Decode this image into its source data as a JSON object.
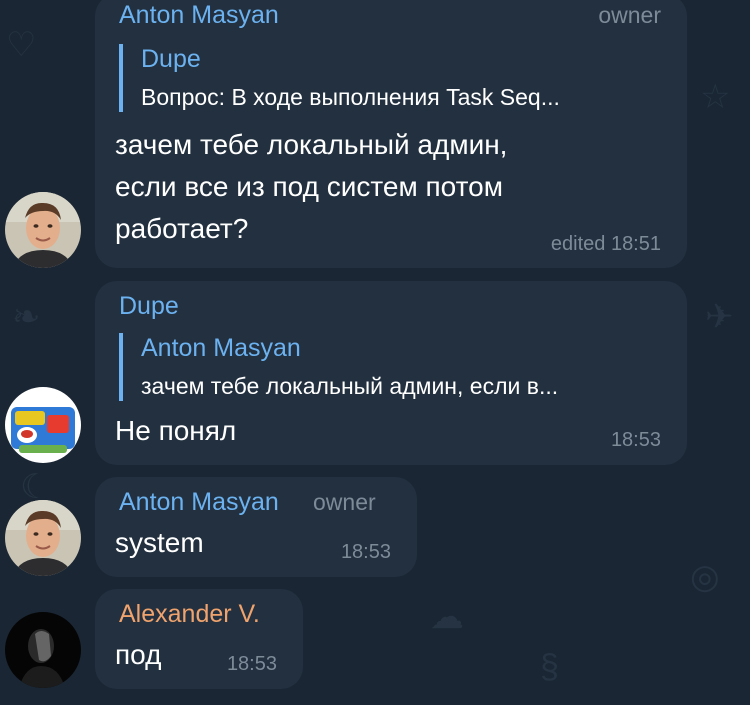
{
  "colors": {
    "background": "#1a2633",
    "bubble": "#22303f",
    "text": "#ffffff",
    "meta": "#7d8b99",
    "accent_blue": "#6cb2f0",
    "accent_orange": "#f0a36d"
  },
  "messages": [
    {
      "sender": "Anton Masyan",
      "sender_color": "#6cb2f0",
      "role": "owner",
      "reply_author": "Dupe",
      "reply_text": "Вопрос: В ходе выполнения Task Seq...",
      "text": "зачем тебе локальный админ,\nесли все из под систем потом\nработает?",
      "time": "edited 18:51",
      "avatar_icon": "man-photo-avatar"
    },
    {
      "sender": "Dupe",
      "sender_color": "#6cb2f0",
      "reply_author": "Anton Masyan",
      "reply_text": "зачем тебе локальный админ, если в...",
      "text": "Не понял",
      "time": "18:53",
      "avatar_icon": "pringles-avatar"
    },
    {
      "sender": "Anton Masyan",
      "sender_color": "#6cb2f0",
      "role": "owner",
      "text": "system",
      "time": "18:53",
      "avatar_icon": "man-photo-avatar"
    },
    {
      "sender": "Alexander V.",
      "sender_color": "#f0a36d",
      "text": "под",
      "time": "18:53",
      "avatar_icon": "dark-portrait-avatar"
    }
  ]
}
